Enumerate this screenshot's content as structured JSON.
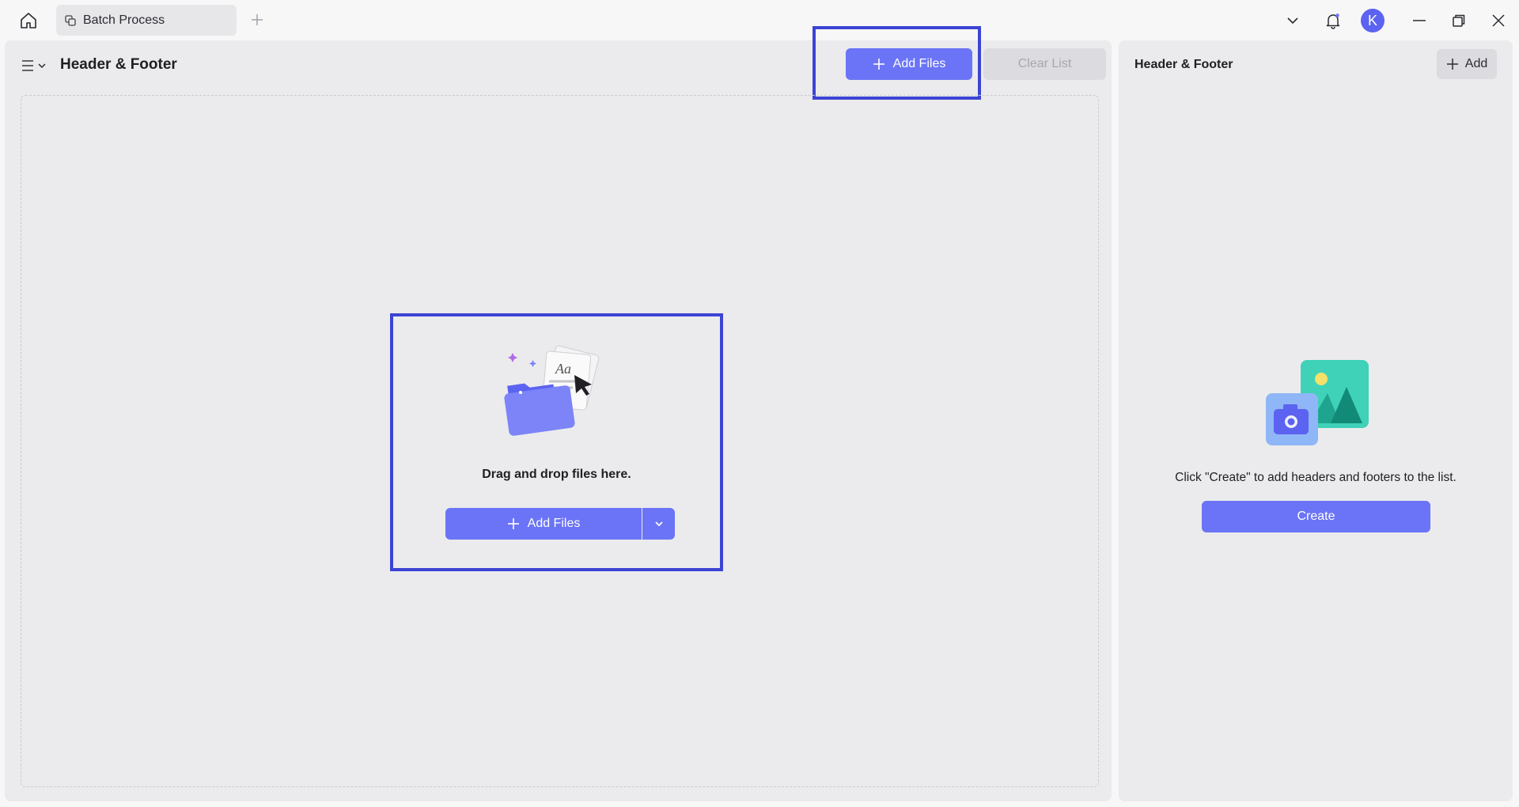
{
  "titlebar": {
    "tab_label": "Batch Process",
    "avatar_initial": "K"
  },
  "main": {
    "title": "Header & Footer",
    "add_files_label": "Add Files",
    "clear_list_label": "Clear List",
    "drop_text": "Drag and drop files here.",
    "drop_add_files_label": "Add Files",
    "drop_icon_text": "Aa"
  },
  "side": {
    "title": "Header & Footer",
    "add_label": "Add",
    "empty_text": "Click \"Create\" to add headers and footers to the list.",
    "create_label": "Create"
  },
  "colors": {
    "accent": "#6b74f6",
    "highlight": "#3c44d4",
    "panel": "#ebebed"
  }
}
